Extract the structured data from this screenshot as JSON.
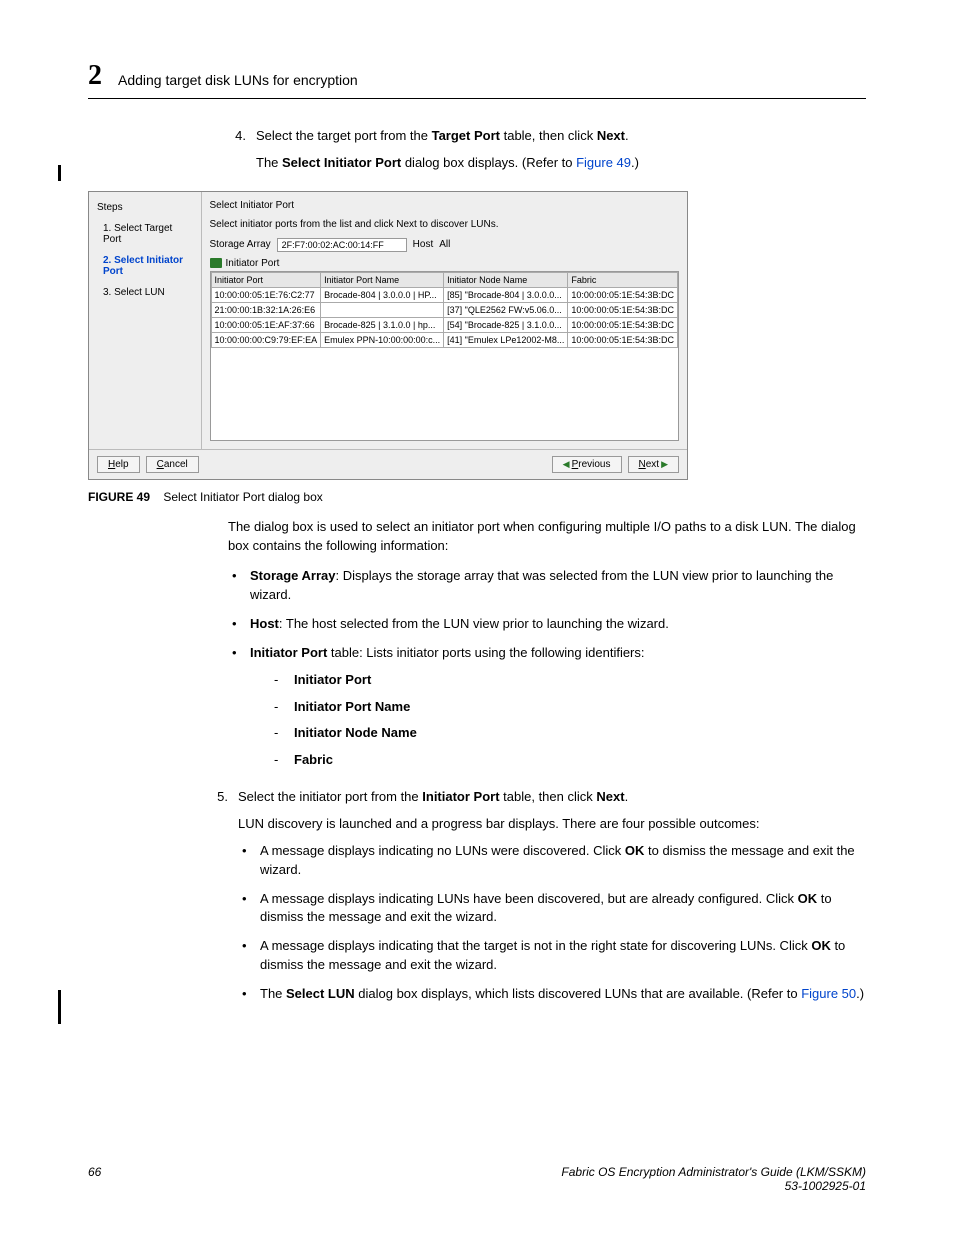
{
  "header": {
    "chapter_num": "2",
    "title": "Adding target disk LUNs for encryption"
  },
  "step4": {
    "num": "4.",
    "line1_a": "Select the target port from the ",
    "line1_b": "Target Port",
    "line1_c": " table, then click ",
    "line1_d": "Next",
    "line1_e": ".",
    "line2_a": "The ",
    "line2_b": "Select Initiator Port",
    "line2_c": " dialog box displays. (Refer to ",
    "line2_d": "Figure 49",
    "line2_e": ".)"
  },
  "dialog": {
    "steps_label": "Steps",
    "steps": {
      "s1": "1. Select Target Port",
      "s2": "2. Select Initiator Port",
      "s3": "3. Select LUN"
    },
    "title": "Select Initiator Port",
    "subtitle": "Select initiator ports from the list and click Next to discover LUNs.",
    "storage_label": "Storage Array",
    "storage_val": "2F:F7:00:02:AC:00:14:FF",
    "host_label": "Host",
    "host_val": "All",
    "ip_label": "Initiator Port",
    "cols": {
      "c1": "Initiator Port",
      "c2": "Initiator Port Name",
      "c3": "Initiator Node Name",
      "c4": "Fabric"
    },
    "rows": [
      {
        "c1": "10:00:00:05:1E:76:C2:77",
        "c2": "Brocade-804 | 3.0.0.0 | HP...",
        "c3": "[85] \"Brocade-804 | 3.0.0.0...",
        "c4": "10:00:00:05:1E:54:3B:DC"
      },
      {
        "c1": "21:00:00:1B:32:1A:26:E6",
        "c2": "",
        "c3": "[37] \"QLE2562 FW:v5.06.0...",
        "c4": "10:00:00:05:1E:54:3B:DC"
      },
      {
        "c1": "10:00:00:05:1E:AF:37:66",
        "c2": "Brocade-825 | 3.1.0.0 | hp...",
        "c3": "[54] \"Brocade-825 | 3.1.0.0...",
        "c4": "10:00:00:05:1E:54:3B:DC"
      },
      {
        "c1": "10:00:00:00:C9:79:EF:EA",
        "c2": "Emulex PPN-10:00:00:00:c...",
        "c3": "[41] \"Emulex LPe12002-M8...",
        "c4": "10:00:00:05:1E:54:3B:DC"
      }
    ],
    "buttons": {
      "help": "Help",
      "cancel": "Cancel",
      "previous": "Previous",
      "next": "Next"
    }
  },
  "fig49": {
    "label": "FIGURE 49",
    "caption": "Select Initiator Port dialog box"
  },
  "para_intro": "The dialog box is used to select an initiator port when configuring multiple I/O paths to a disk LUN. The dialog box contains the following information:",
  "info_bullets": {
    "b1a": "Storage Array",
    "b1b": ": Displays the storage array that was selected from the LUN view prior to launching the wizard.",
    "b2a": "Host",
    "b2b": ": The host selected from the LUN view prior to launching the wizard.",
    "b3a": "Initiator Port",
    "b3b": " table: Lists initiator ports using the following identifiers:",
    "d1": "Initiator Port",
    "d2": "Initiator Port Name",
    "d3": "Initiator Node Name",
    "d4": "Fabric"
  },
  "step5": {
    "num": "5.",
    "line1_a": "Select the initiator port from the ",
    "line1_b": "Initiator Port",
    "line1_c": " table, then click ",
    "line1_d": "Next",
    "line1_e": ".",
    "line2": "LUN discovery is launched and a progress bar displays. There are four possible outcomes:",
    "o1a": "A message displays indicating no LUNs were discovered. Click ",
    "o1b": "OK",
    "o1c": " to dismiss the message and exit the wizard.",
    "o2a": "A message displays indicating LUNs have been discovered, but are already configured. Click ",
    "o2b": "OK",
    "o2c": " to dismiss the message and exit the wizard.",
    "o3a": "A message displays indicating that the target is not in the right state for discovering LUNs. Click ",
    "o3b": "OK",
    "o3c": " to dismiss the message and exit the wizard.",
    "o4a": "The ",
    "o4b": "Select LUN",
    "o4c": " dialog box displays, which lists discovered LUNs that are available. (Refer to ",
    "o4d": "Figure 50",
    "o4e": ".)"
  },
  "footer": {
    "page": "66",
    "right1": "Fabric OS Encryption Administrator's Guide (LKM/SSKM)",
    "right2": "53-1002925-01"
  }
}
